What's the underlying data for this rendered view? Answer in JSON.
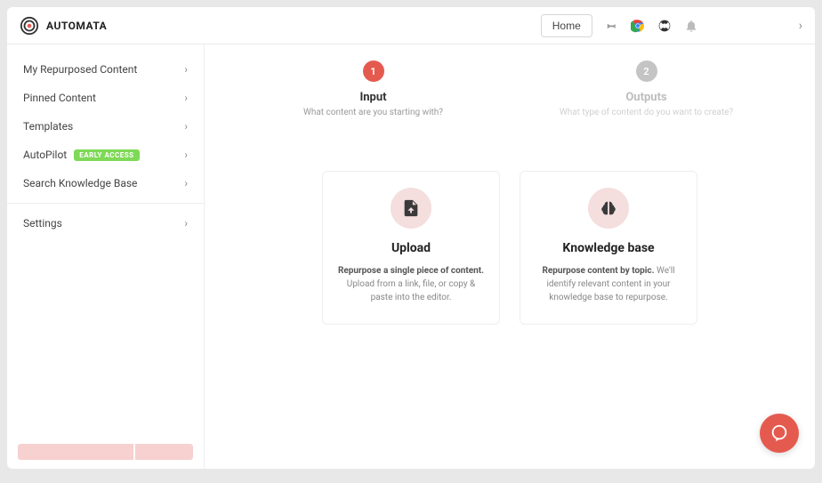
{
  "brand": {
    "name": "AUTOMATA"
  },
  "topbar": {
    "home_label": "Home"
  },
  "sidebar": {
    "items": [
      {
        "label": "My Repurposed Content"
      },
      {
        "label": "Pinned Content"
      },
      {
        "label": "Templates"
      },
      {
        "label": "AutoPilot",
        "badge": "EARLY ACCESS"
      },
      {
        "label": "Search Knowledge Base"
      }
    ],
    "settings_label": "Settings"
  },
  "stepper": {
    "step1": {
      "num": "1",
      "title": "Input",
      "sub": "What content are you starting with?"
    },
    "step2": {
      "num": "2",
      "title": "Outputs",
      "sub": "What type of content do you want to create?"
    }
  },
  "cards": {
    "upload": {
      "title": "Upload",
      "desc_bold": "Repurpose a single piece of content.",
      "desc_rest": " Upload from a link, file, or copy & paste into the editor."
    },
    "kb": {
      "title": "Knowledge base",
      "desc_bold": "Repurpose content by topic.",
      "desc_rest": " We'll identify relevant content in your knowledge base to repurpose."
    }
  }
}
